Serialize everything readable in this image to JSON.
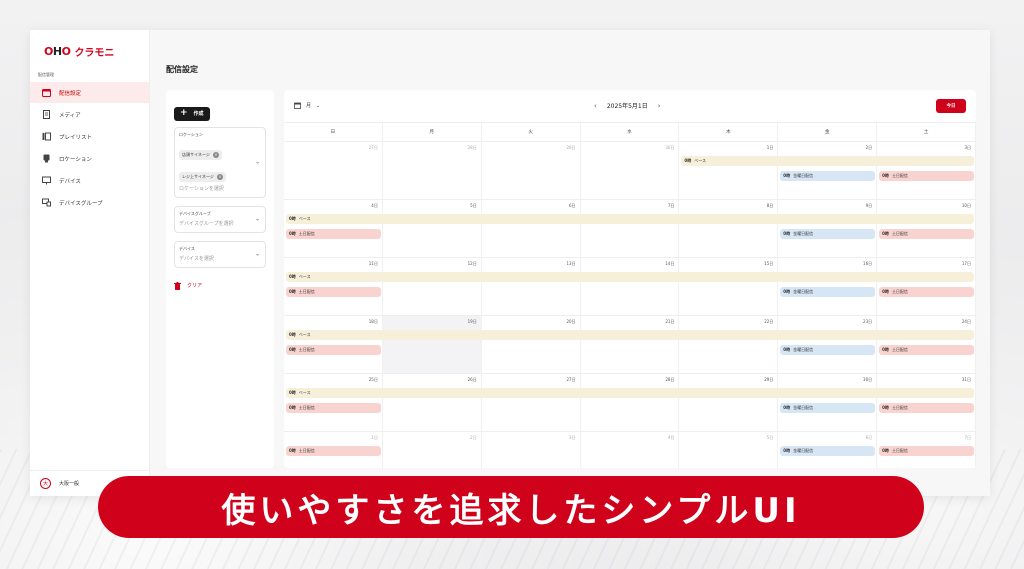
{
  "brand": {
    "logo_prefix": "OHO",
    "logo_name": "クラモニ"
  },
  "sidebar": {
    "section_label": "配信管理",
    "items": [
      {
        "label": "配信設定",
        "icon": "calendar-icon",
        "active": true
      },
      {
        "label": "メディア",
        "icon": "document-icon",
        "active": false
      },
      {
        "label": "プレイリスト",
        "icon": "playlist-icon",
        "active": false
      },
      {
        "label": "ロケーション",
        "icon": "location-icon",
        "active": false
      },
      {
        "label": "デバイス",
        "icon": "monitor-icon",
        "active": false
      },
      {
        "label": "デバイスグループ",
        "icon": "device-group-icon",
        "active": false
      }
    ],
    "user": {
      "avatar_letter": "大",
      "name": "大阪一般"
    }
  },
  "page": {
    "title": "配信設定"
  },
  "filters": {
    "create_label": "作成",
    "location": {
      "label": "ロケーション",
      "chips": [
        "店頭サイネージ",
        "レジ上サイネージ"
      ],
      "placeholder": "ロケーションを選択"
    },
    "device_group": {
      "label": "デバイスグループ",
      "placeholder": "デバイスグループを選択"
    },
    "device": {
      "label": "デバイス",
      "placeholder": "デバイスを選択"
    },
    "clear_label": "クリア"
  },
  "calendar": {
    "view_label": "月",
    "month_label": "2025年5月1日",
    "today_label": "今日",
    "weekdays": [
      "日",
      "月",
      "火",
      "水",
      "木",
      "金",
      "土"
    ],
    "weeks": [
      {
        "days": [
          "27日",
          "28日",
          "29日",
          "30日",
          "1日",
          "2日",
          "3日"
        ],
        "muted": [
          0,
          1,
          2,
          3
        ],
        "base": {
          "start": 4,
          "text": "ベース"
        },
        "blue": true,
        "pink": true,
        "pink_sun": false
      },
      {
        "days": [
          "4日",
          "5日",
          "6日",
          "7日",
          "8日",
          "9日",
          "10日"
        ],
        "muted": [],
        "base": {
          "start": 0,
          "text": "ベース"
        },
        "blue": true,
        "pink": true,
        "pink_sun": true
      },
      {
        "days": [
          "11日",
          "12日",
          "13日",
          "14日",
          "15日",
          "16日",
          "17日"
        ],
        "muted": [],
        "base": {
          "start": 0,
          "text": "ベース"
        },
        "blue": true,
        "pink": true,
        "pink_sun": true
      },
      {
        "days": [
          "18日",
          "19日",
          "20日",
          "21日",
          "22日",
          "23日",
          "24日"
        ],
        "muted": [],
        "base": {
          "start": 0,
          "text": "ベース"
        },
        "blue": true,
        "pink": true,
        "pink_sun": true,
        "highlight": 1
      },
      {
        "days": [
          "25日",
          "26日",
          "27日",
          "28日",
          "29日",
          "30日",
          "31日"
        ],
        "muted": [],
        "base": {
          "start": 0,
          "text": "ベース"
        },
        "blue": true,
        "pink": true,
        "pink_sun": true
      },
      {
        "days": [
          "1日",
          "2日",
          "3日",
          "4日",
          "5日",
          "6日",
          "7日"
        ],
        "muted": [
          0,
          1,
          2,
          3,
          4,
          5,
          6
        ],
        "base": null,
        "blue": true,
        "pink": true,
        "pink_sun": true,
        "shift": true
      }
    ],
    "event_time": "0時",
    "events": {
      "blue": "金曜日配信",
      "pink": "土日配信"
    }
  },
  "banner": {
    "text": "使いやすさを追求したシンプルUI"
  }
}
